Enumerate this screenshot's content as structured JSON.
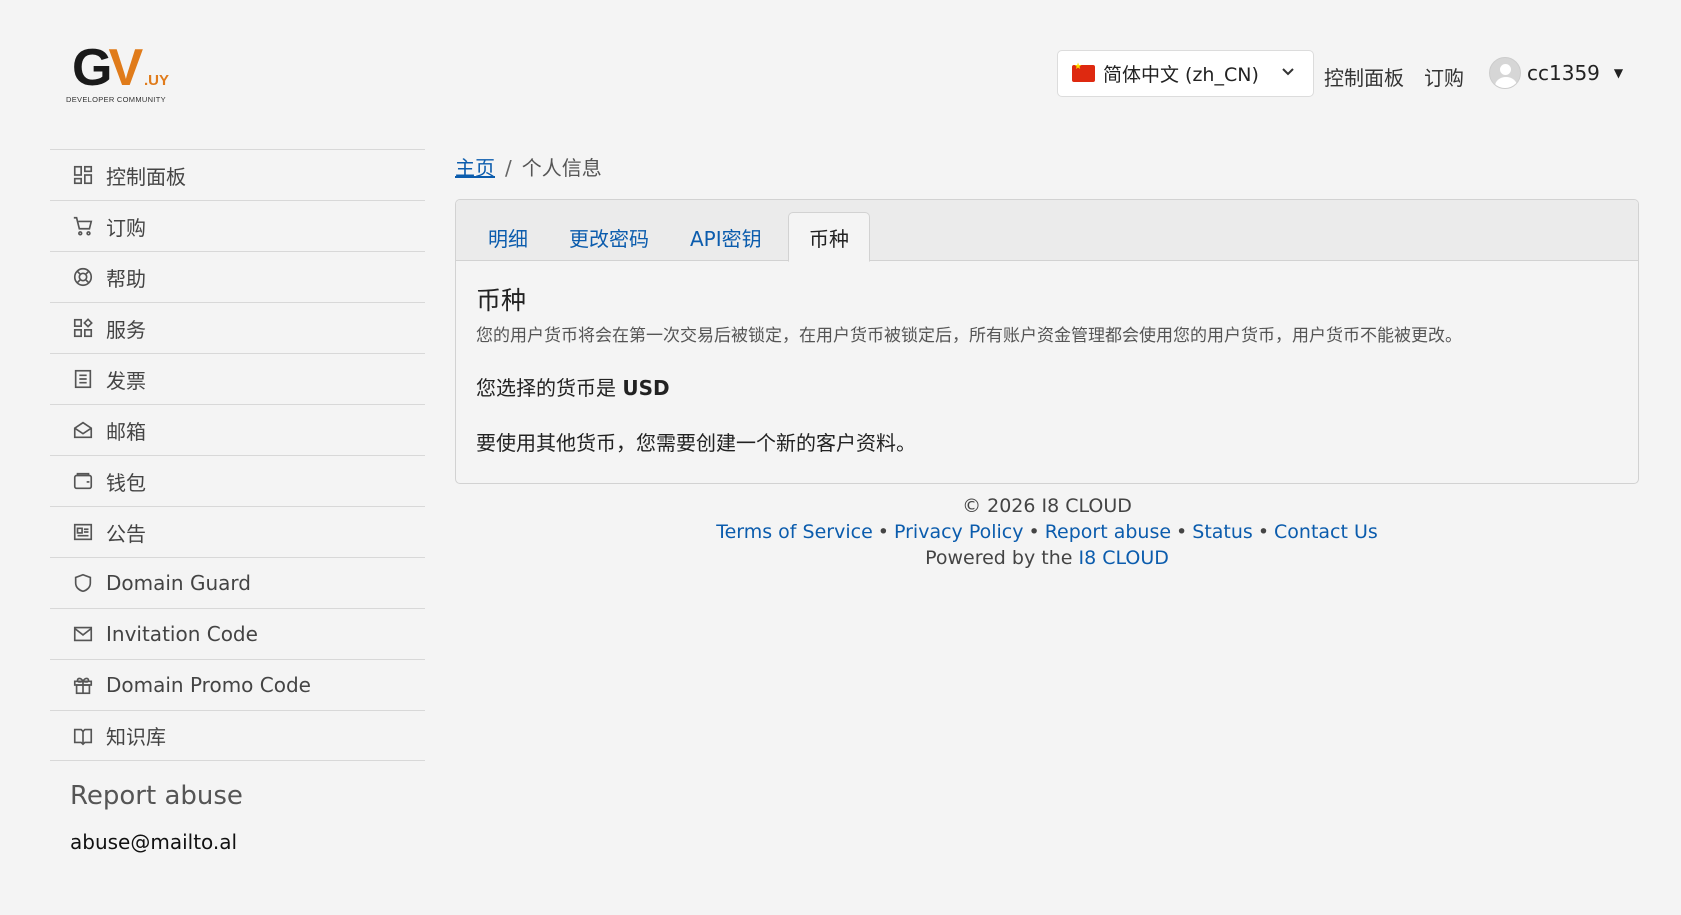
{
  "header": {
    "logo": {
      "main": "GV",
      "suffix": ".UY",
      "subtitle": "DEVELOPER COMMUNITY"
    },
    "language": {
      "flag": "cn-flag",
      "label": "简体中文 (zh_CN)"
    },
    "nav": {
      "dashboard": "控制面板",
      "order": "订购"
    },
    "user": {
      "name": "cc1359"
    }
  },
  "sidebar": {
    "items": [
      {
        "label": "控制面板",
        "icon": "dashboard-icon"
      },
      {
        "label": "订购",
        "icon": "cart-icon"
      },
      {
        "label": "帮助",
        "icon": "lifebuoy-icon"
      },
      {
        "label": "服务",
        "icon": "services-icon"
      },
      {
        "label": "发票",
        "icon": "invoice-icon"
      },
      {
        "label": "邮箱",
        "icon": "mail-open-icon"
      },
      {
        "label": "钱包",
        "icon": "wallet-icon"
      },
      {
        "label": "公告",
        "icon": "news-icon"
      },
      {
        "label": "Domain Guard",
        "icon": "shield-icon"
      },
      {
        "label": "Invitation Code",
        "icon": "envelope-icon"
      },
      {
        "label": "Domain Promo Code",
        "icon": "gift-icon"
      },
      {
        "label": "知识库",
        "icon": "book-icon"
      }
    ],
    "report": {
      "title": "Report abuse",
      "email": "abuse@mailto.al"
    }
  },
  "breadcrumb": {
    "home": "主页",
    "separator": "/",
    "current": "个人信息"
  },
  "tabs": [
    {
      "label": "明细",
      "active": false
    },
    {
      "label": "更改密码",
      "active": false
    },
    {
      "label": "API密钥",
      "active": false
    },
    {
      "label": "币种",
      "active": true
    }
  ],
  "content": {
    "title": "币种",
    "description": "您的用户货币将会在第一次交易后被锁定，在用户货币被锁定后，所有账户资金管理都会使用您的用户货币，用户货币不能被更改。",
    "selected_prefix": "您选择的货币是",
    "selected_currency": "USD",
    "note": "要使用其他货币，您需要创建一个新的客户资料。"
  },
  "footer": {
    "copyright": "© 2026 I8 CLOUD",
    "links": [
      "Terms of Service",
      "Privacy Policy",
      "Report abuse",
      "Status",
      "Contact Us"
    ],
    "separator": "•",
    "powered_prefix": "Powered by the",
    "powered_link": "I8 CLOUD"
  }
}
